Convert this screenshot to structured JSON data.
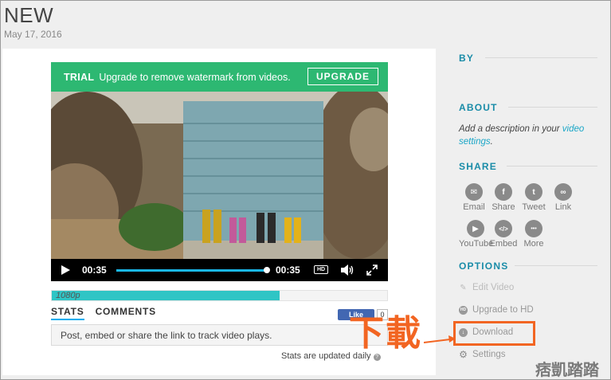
{
  "page": {
    "title": "NEW",
    "date": "May 17, 2016"
  },
  "player": {
    "trial_tag": "TRIAL",
    "trial_message": "Upgrade to remove watermark from videos.",
    "upgrade_label": "UPGRADE",
    "current_time": "00:35",
    "end_time": "00:35",
    "hd_label": "HD",
    "progress_fraction": 1.0
  },
  "upload": {
    "resolution_label": "1080p",
    "fraction": 0.68
  },
  "tabs": [
    {
      "label": "STATS",
      "active": true
    },
    {
      "label": "COMMENTS",
      "active": false
    }
  ],
  "like": {
    "label": "Like",
    "count": "0"
  },
  "stats": {
    "message": "Post, embed or share the link to track video plays.",
    "note": "Stats are updated daily"
  },
  "sidebar": {
    "by_title": "BY",
    "about_title": "ABOUT",
    "about_text_prefix": "Add a description in your ",
    "about_link": "video settings",
    "about_text_suffix": ".",
    "share_title": "SHARE",
    "share_items": [
      {
        "label": "Email",
        "icon": "email-icon",
        "glyph": "✉"
      },
      {
        "label": "Share",
        "icon": "facebook-icon",
        "glyph": "f"
      },
      {
        "label": "Tweet",
        "icon": "twitter-icon",
        "glyph": "t"
      },
      {
        "label": "Link",
        "icon": "link-icon",
        "glyph": "∞"
      },
      {
        "label": "YouTube",
        "icon": "youtube-icon",
        "glyph": "▶"
      },
      {
        "label": "Embed",
        "icon": "embed-icon",
        "glyph": "</>"
      },
      {
        "label": "More",
        "icon": "more-icon",
        "glyph": "•••"
      }
    ],
    "options_title": "OPTIONS",
    "options": [
      {
        "label": "Edit Video",
        "icon": "pencil-icon",
        "glyph": "✎"
      },
      {
        "label": "Upgrade to HD",
        "icon": "hd-icon",
        "glyph": "HD"
      },
      {
        "label": "Download",
        "icon": "download-icon",
        "glyph": "↓"
      },
      {
        "label": "Settings",
        "icon": "gear-icon",
        "glyph": "⚙"
      }
    ]
  },
  "annotation": {
    "text": "下載",
    "watermark": "痞凱踏踏"
  },
  "colors": {
    "accent": "#1a8ca8",
    "trial_green": "#2db872",
    "progress": "#2fc5c5",
    "annotation": "#f26522"
  }
}
